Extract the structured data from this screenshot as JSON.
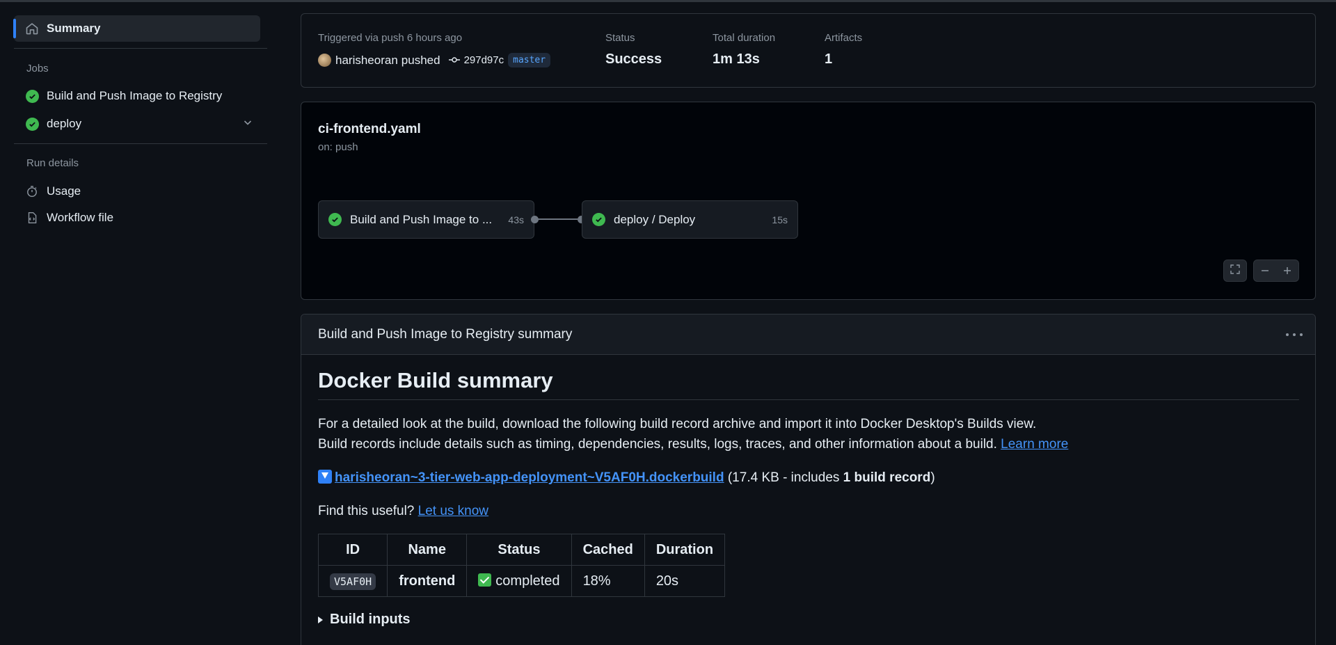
{
  "sidebar": {
    "summary_label": "Summary",
    "jobs_heading": "Jobs",
    "jobs": [
      {
        "label": "Build and Push Image to Registry",
        "status": "success"
      },
      {
        "label": "deploy",
        "status": "success"
      }
    ],
    "run_details_heading": "Run details",
    "run_details": [
      {
        "label": "Usage",
        "icon": "stopwatch-icon"
      },
      {
        "label": "Workflow file",
        "icon": "file-code-icon"
      }
    ]
  },
  "run_meta": {
    "trigger_text": "Triggered via push 6 hours ago",
    "actor": "harisheoran",
    "action": "pushed",
    "commit_sha": "297d97c",
    "branch": "master",
    "status_label": "Status",
    "status_value": "Success",
    "duration_label": "Total duration",
    "duration_value": "1m 13s",
    "artifacts_label": "Artifacts",
    "artifacts_value": "1"
  },
  "workflow_graph": {
    "file_name": "ci-frontend.yaml",
    "trigger": "on: push",
    "jobs": [
      {
        "name": "Build and Push Image to ...",
        "duration": "43s",
        "status": "success"
      },
      {
        "name": "deploy / Deploy",
        "duration": "15s",
        "status": "success"
      }
    ]
  },
  "job_summary": {
    "header": "Build and Push Image to Registry summary",
    "heading": "Docker Build summary",
    "intro_line1": "For a detailed look at the build, download the following build record archive and import it into Docker Desktop's Builds view.",
    "intro_line2": "Build records include details such as timing, dependencies, results, logs, traces, and other information about a build.",
    "learn_more": "Learn more",
    "archive_link": "harisheoran~3-tier-web-app-deployment~V5AF0H.dockerbuild",
    "archive_size_prefix": "(17.4 KB - includes ",
    "archive_size_bold": "1 build record",
    "archive_size_suffix": ")",
    "useful_text": "Find this useful?",
    "useful_link": "Let us know",
    "table": {
      "headers": [
        "ID",
        "Name",
        "Status",
        "Cached",
        "Duration"
      ],
      "rows": [
        {
          "id": "V5AF0H",
          "name": "frontend",
          "status": "completed",
          "cached": "18%",
          "duration": "20s"
        }
      ]
    },
    "build_inputs_label": "Build inputs"
  },
  "colors": {
    "background": "#0d1117",
    "success": "#3fb950",
    "accent": "#2f81f7",
    "link": "#4493f8"
  }
}
